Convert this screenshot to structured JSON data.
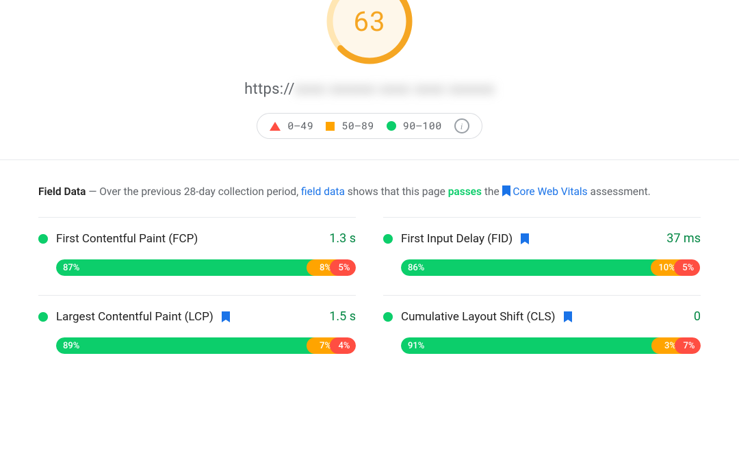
{
  "score": {
    "value": "63",
    "percent": 63,
    "color": "#f5a623"
  },
  "url_prefix": "https://",
  "url_hidden": "xxxx xxxxxx xxxx xxxx xxxxxx",
  "legend": {
    "poor": "0–49",
    "avg": "50–89",
    "good": "90–100"
  },
  "field": {
    "title": "Field Data",
    "lead1": " —  Over the previous 28-day collection period, ",
    "link_field_data": "field data",
    "lead2": " shows that this page ",
    "passes_word": "passes",
    "lead3": " the ",
    "cwv_link": "Core Web Vitals",
    "lead4": " assessment."
  },
  "metrics": [
    {
      "status": "good",
      "label": "First Contentful Paint (FCP)",
      "cwv": false,
      "value": "1.3 s",
      "dist": {
        "good": "87%",
        "avg": "8%",
        "poor": "5%"
      }
    },
    {
      "status": "good",
      "label": "First Input Delay (FID)",
      "cwv": true,
      "value": "37 ms",
      "dist": {
        "good": "86%",
        "avg": "10%",
        "poor": "5%"
      }
    },
    {
      "status": "good",
      "label": "Largest Contentful Paint (LCP)",
      "cwv": true,
      "value": "1.5 s",
      "dist": {
        "good": "89%",
        "avg": "7%",
        "poor": "4%"
      }
    },
    {
      "status": "good",
      "label": "Cumulative Layout Shift (CLS)",
      "cwv": true,
      "value": "0",
      "dist": {
        "good": "91%",
        "avg": "3%",
        "poor": "7%"
      }
    }
  ]
}
